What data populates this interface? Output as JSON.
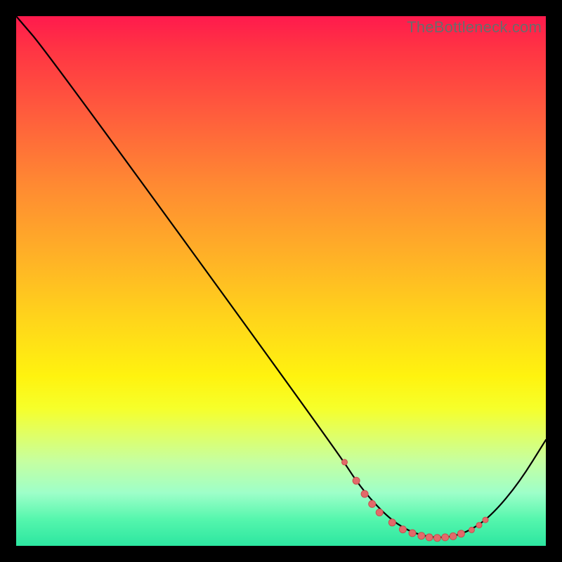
{
  "watermark": "TheBottleneck.com",
  "colors": {
    "dot_fill": "#e26a6a",
    "dot_stroke": "#c94f4f",
    "line": "#000000",
    "bg": "#000000"
  },
  "chart_data": {
    "type": "line",
    "title": "",
    "xlabel": "",
    "ylabel": "",
    "xlim": [
      0,
      100
    ],
    "ylim": [
      0,
      100
    ],
    "grid": false,
    "legend": false,
    "description": "Bottleneck-style curve: steep descent from top-left to a broad minimum near x≈80, then rise toward the right edge. Highlighted points cluster in the trough region.",
    "series": [
      {
        "name": "curve",
        "type": "line",
        "points": [
          {
            "x": 0.0,
            "y": 100.0
          },
          {
            "x": 6.0,
            "y": 93.0
          },
          {
            "x": 60.5,
            "y": 18.0
          },
          {
            "x": 65.0,
            "y": 11.0
          },
          {
            "x": 70.0,
            "y": 5.5
          },
          {
            "x": 74.0,
            "y": 2.8
          },
          {
            "x": 78.0,
            "y": 1.6
          },
          {
            "x": 82.0,
            "y": 1.6
          },
          {
            "x": 86.0,
            "y": 3.0
          },
          {
            "x": 90.0,
            "y": 6.0
          },
          {
            "x": 95.0,
            "y": 12.0
          },
          {
            "x": 100.0,
            "y": 20.0
          }
        ]
      },
      {
        "name": "highlight-dots",
        "type": "scatter",
        "points": [
          {
            "x": 62.0,
            "y": 15.8,
            "r": 4
          },
          {
            "x": 64.2,
            "y": 12.3,
            "r": 5
          },
          {
            "x": 65.8,
            "y": 9.8,
            "r": 5
          },
          {
            "x": 67.2,
            "y": 7.9,
            "r": 5
          },
          {
            "x": 68.6,
            "y": 6.3,
            "r": 5
          },
          {
            "x": 71.0,
            "y": 4.4,
            "r": 5
          },
          {
            "x": 73.0,
            "y": 3.1,
            "r": 5
          },
          {
            "x": 74.8,
            "y": 2.4,
            "r": 5
          },
          {
            "x": 76.5,
            "y": 1.9,
            "r": 5
          },
          {
            "x": 78.0,
            "y": 1.6,
            "r": 5
          },
          {
            "x": 79.5,
            "y": 1.5,
            "r": 5
          },
          {
            "x": 81.0,
            "y": 1.6,
            "r": 5
          },
          {
            "x": 82.5,
            "y": 1.8,
            "r": 5
          },
          {
            "x": 84.0,
            "y": 2.3,
            "r": 5
          },
          {
            "x": 86.0,
            "y": 3.0,
            "r": 4
          },
          {
            "x": 87.4,
            "y": 3.9,
            "r": 4
          },
          {
            "x": 88.6,
            "y": 4.9,
            "r": 4
          }
        ]
      }
    ]
  }
}
